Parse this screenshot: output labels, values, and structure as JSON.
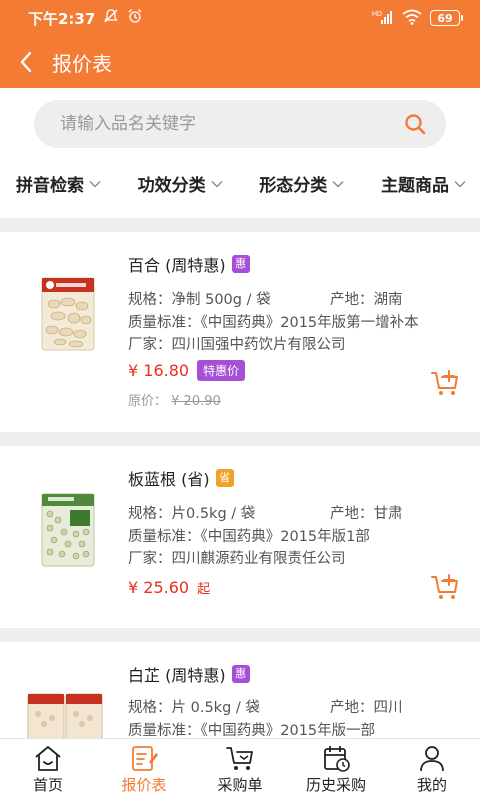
{
  "status": {
    "time": "下午2:37",
    "network": "HD",
    "battery": "69"
  },
  "header": {
    "title": "报价表"
  },
  "search": {
    "placeholder": "请输入品名关键字"
  },
  "filters": [
    {
      "label": "拼音检索"
    },
    {
      "label": "功效分类"
    },
    {
      "label": "形态分类"
    },
    {
      "label": "主题商品"
    }
  ],
  "products": [
    {
      "name": "百合 (周特惠)",
      "tag": "惠",
      "spec": "规格：净制 500g / 袋",
      "origin": "产地：湖南",
      "standard": "质量标准：《中国药典》2015年版第一增补本",
      "maker": "厂家：四川国强中药饮片有限公司",
      "price": "¥ 16.80",
      "badge": "特惠价",
      "orig_label": "原价：",
      "orig_price": "¥ 20.90"
    },
    {
      "name": "板蓝根 (省)",
      "tag": "省",
      "spec": "规格：片0.5kg / 袋",
      "origin": "产地：甘肃",
      "standard": "质量标准：《中国药典》2015年版1部",
      "maker": "厂家：四川麒源药业有限责任公司",
      "price": "¥ 25.60",
      "suffix": "起"
    },
    {
      "name": "白芷 (周特惠)",
      "tag": "惠",
      "spec": "规格：片 0.5kg / 袋",
      "origin": "产地：四川",
      "standard": "质量标准：《中国药典》2015年版一部"
    }
  ],
  "nav": [
    {
      "label": "首页",
      "icon": "home-icon"
    },
    {
      "label": "报价表",
      "icon": "price-list-icon"
    },
    {
      "label": "采购单",
      "icon": "cart-icon"
    },
    {
      "label": "历史采购",
      "icon": "calendar-icon"
    },
    {
      "label": "我的",
      "icon": "user-icon"
    }
  ],
  "colors": {
    "accent": "#f47b34",
    "price": "#e8301c",
    "hui_tag": "#a74fd6",
    "sheng_tag": "#f0a127"
  }
}
